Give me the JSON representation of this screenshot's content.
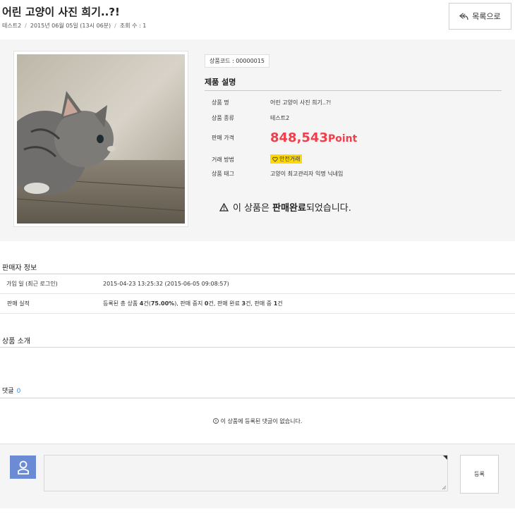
{
  "post": {
    "title": "어린 고양이 사진 희기..?!",
    "author": "테스트2",
    "date": "2015년 06월 05일 (13시 06분)",
    "views": "조회 수 : 1",
    "back_label": "목록으로"
  },
  "product": {
    "code": "상품코드 : 00000015",
    "section_title": "제품 설명",
    "specs": {
      "name_label": "상품 명",
      "name_value": "어린 고양이 사진 희기..?!",
      "category_label": "상품 종류",
      "category_value": "테스트2",
      "price_label": "판매 가격",
      "price_value": "848,543",
      "price_unit": "Point",
      "method_label": "거래 방법",
      "method_value": "안전거래",
      "tag_label": "상품 태그",
      "tag_value": "고양이 최고관리자 익명 닉네임"
    },
    "sold": {
      "prefix": "이 상품은",
      "bold": "판매완료",
      "suffix": "되었습니다."
    }
  },
  "seller": {
    "title": "판매자 정보",
    "rows": [
      {
        "label": "가입 일 (최근 로그인)",
        "value": "2015-04-23 13:25:32 (2015-06-05 09:08:57)"
      },
      {
        "label": "판매 실적",
        "value_parts": [
          "등록된 총 상품 ",
          "4",
          "건(",
          "75.00%",
          "), 판매 중지 ",
          "0",
          "건, 판매 완료 ",
          "3",
          "건, 판매 중 ",
          "1",
          "건"
        ]
      }
    ]
  },
  "intro": {
    "title": "상품 소개"
  },
  "comments": {
    "title": "댓글",
    "count": "0",
    "empty_message": "이 상품에 등록된 댓글이 없습니다.",
    "submit_label": "등록"
  },
  "colors": {
    "price": "#f23e4b",
    "safe_badge": "#ffd900",
    "avatar": "#6b8bd4",
    "comment_count": "#3a8fdb"
  }
}
